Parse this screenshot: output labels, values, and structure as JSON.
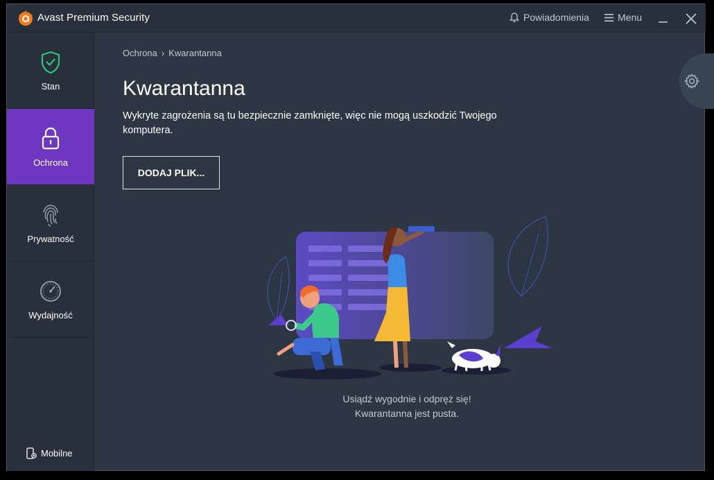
{
  "app": {
    "title": "Avast Premium Security"
  },
  "header": {
    "notifications_label": "Powiadomienia",
    "menu_label": "Menu"
  },
  "sidebar": {
    "items": [
      {
        "label": "Stan",
        "icon": "shield-check-icon"
      },
      {
        "label": "Ochrona",
        "icon": "lock-icon",
        "active": true
      },
      {
        "label": "Prywatność",
        "icon": "fingerprint-icon"
      },
      {
        "label": "Wydajność",
        "icon": "gauge-icon"
      }
    ],
    "mobile_label": "Mobilne"
  },
  "breadcrumb": {
    "parent": "Ochrona",
    "separator": "›",
    "current": "Kwarantanna"
  },
  "main": {
    "title": "Kwarantanna",
    "description": "Wykryte zagrożenia są tu bezpiecznie zamknięte, więc nie mogą uszkodzić Twojego komputera.",
    "add_button": "DODAJ PLIK...",
    "empty_line1": "Usiądź wygodnie i odpręż się!",
    "empty_line2": "Kwarantanna jest pusta."
  },
  "colors": {
    "accent_purple": "#6d37bf",
    "brand_orange": "#f57c1f",
    "status_green": "#2ec27e",
    "background": "#2d3744"
  }
}
